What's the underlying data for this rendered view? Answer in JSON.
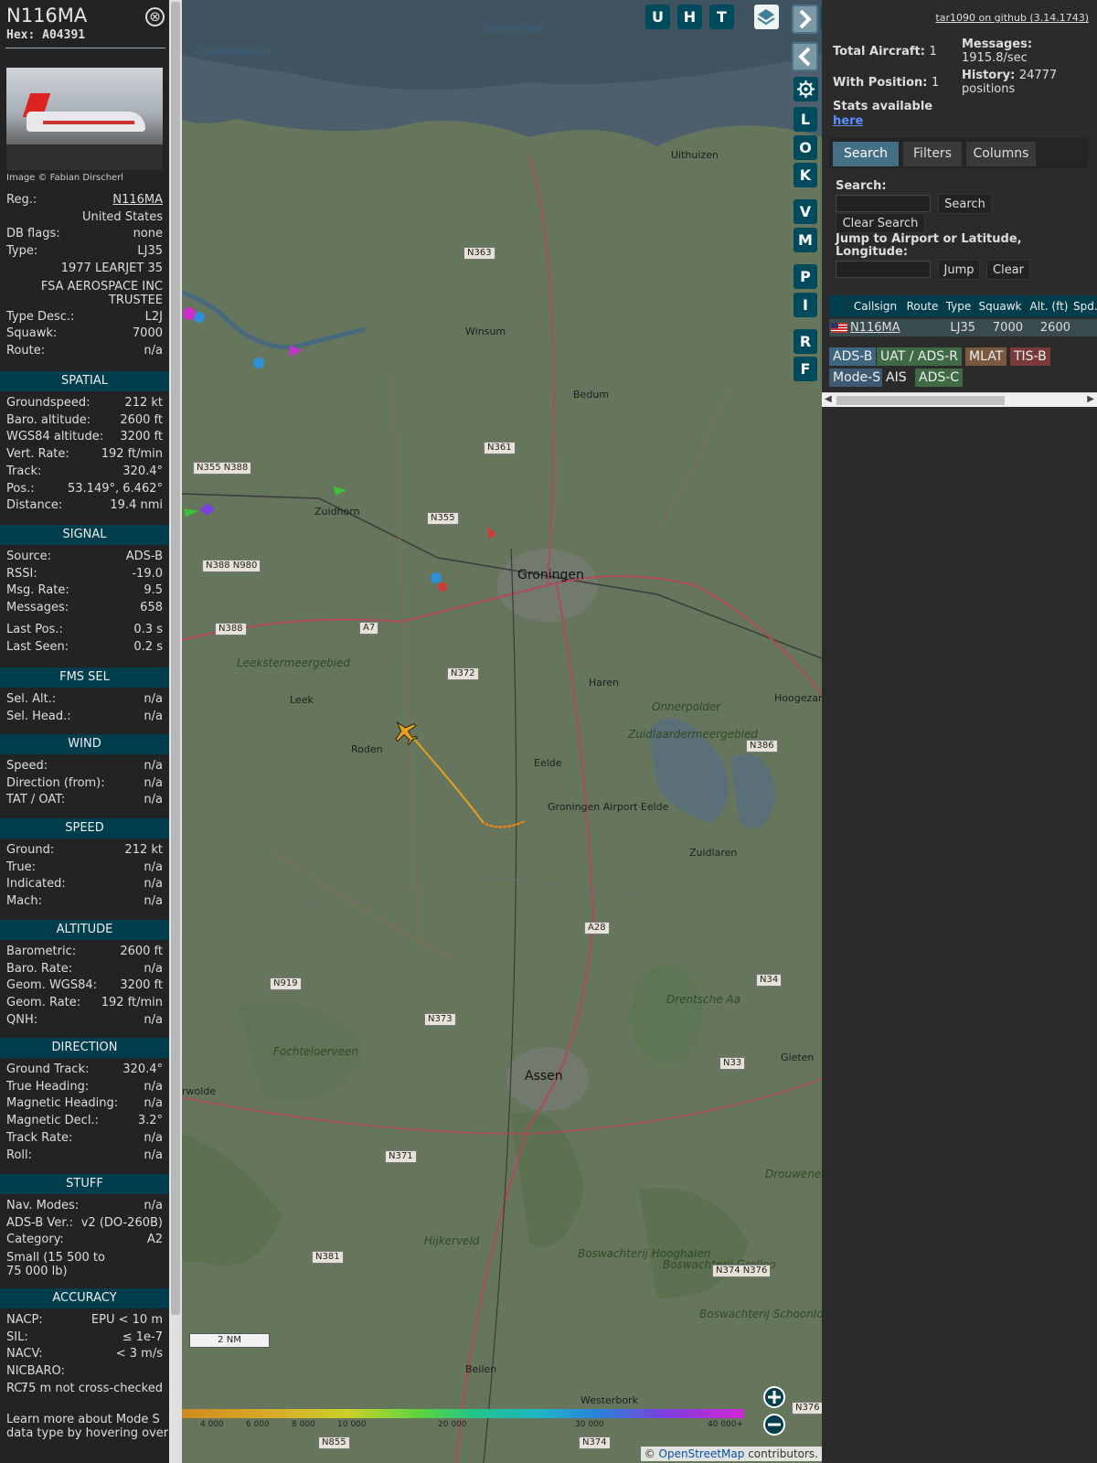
{
  "info": {
    "registration": "N116MA",
    "hex": "Hex: A04391",
    "close_icon": "⊗",
    "photo_credit": "Image © Fabian Dirscherl",
    "details": [
      {
        "k": "Reg.:",
        "v": "N116MA"
      },
      {
        "k": "",
        "v": "United States"
      },
      {
        "k": "DB flags:",
        "v": "none"
      },
      {
        "k": "Type:",
        "v": "LJ35"
      },
      {
        "k": "",
        "v": "1977 LEARJET 35"
      },
      {
        "k": "",
        "v": "FSA AEROSPACE INC TRUSTEE"
      },
      {
        "k": "Type Desc.:",
        "v": "L2J"
      },
      {
        "k": "Squawk:",
        "v": "7000"
      },
      {
        "k": "Route:",
        "v": "n/a"
      }
    ],
    "sections": {
      "spatial": "SPATIAL",
      "signal": "SIGNAL",
      "fms": "FMS SEL",
      "wind": "WIND",
      "speed": "SPEED",
      "altitude": "ALTITUDE",
      "direction": "DIRECTION",
      "stuff": "STUFF",
      "accuracy": "ACCURACY"
    },
    "spatial": [
      {
        "k": "Groundspeed:",
        "v": "212 kt"
      },
      {
        "k": "Baro. altitude:",
        "v": "2600 ft"
      },
      {
        "k": "WGS84 altitude:",
        "v": "3200 ft"
      },
      {
        "k": "Vert. Rate:",
        "v": "192 ft/min"
      },
      {
        "k": "Track:",
        "v": "320.4°"
      },
      {
        "k": "Pos.:",
        "v": "53.149°, 6.462°"
      },
      {
        "k": "Distance:",
        "v": "19.4 nmi"
      }
    ],
    "signal": [
      {
        "k": "Source:",
        "v": "ADS-B"
      },
      {
        "k": "RSSI:",
        "v": "-19.0"
      },
      {
        "k": "Msg. Rate:",
        "v": "9.5"
      },
      {
        "k": "Messages:",
        "v": "658"
      },
      {
        "k": "Last Pos.:",
        "v": "0.3 s"
      },
      {
        "k": "Last Seen:",
        "v": "0.2 s"
      }
    ],
    "fms": [
      {
        "k": "Sel. Alt.:",
        "v": "n/a"
      },
      {
        "k": "Sel. Head.:",
        "v": "n/a"
      }
    ],
    "wind": [
      {
        "k": "Speed:",
        "v": "n/a"
      },
      {
        "k": "Direction (from):",
        "v": "n/a"
      },
      {
        "k": "TAT / OAT:",
        "v": "n/a"
      }
    ],
    "speed": [
      {
        "k": "Ground:",
        "v": "212 kt"
      },
      {
        "k": "True:",
        "v": "n/a"
      },
      {
        "k": "Indicated:",
        "v": "n/a"
      },
      {
        "k": "Mach:",
        "v": "n/a"
      }
    ],
    "altitude": [
      {
        "k": "Barometric:",
        "v": "2600 ft"
      },
      {
        "k": "Baro. Rate:",
        "v": "n/a"
      },
      {
        "k": "Geom. WGS84:",
        "v": "3200 ft"
      },
      {
        "k": "Geom. Rate:",
        "v": "192 ft/min"
      },
      {
        "k": "QNH:",
        "v": "n/a"
      }
    ],
    "direction": [
      {
        "k": "Ground Track:",
        "v": "320.4°"
      },
      {
        "k": "True Heading:",
        "v": "n/a"
      },
      {
        "k": "Magnetic Heading:",
        "v": "n/a"
      },
      {
        "k": "Magnetic Decl.:",
        "v": "3.2°"
      },
      {
        "k": "Track Rate:",
        "v": "n/a"
      },
      {
        "k": "Roll:",
        "v": "n/a"
      }
    ],
    "stuff": [
      {
        "k": "Nav. Modes:",
        "v": "n/a"
      },
      {
        "k": "ADS-B Ver.:",
        "v": "v2 (DO-260B)"
      },
      {
        "k": "Category:",
        "v": "A2"
      }
    ],
    "category_desc": "Small (15 500 to 75 000 lb)",
    "accuracy": [
      {
        "k": "NACP:",
        "v": "EPU < 10 m"
      },
      {
        "k": "SIL:",
        "v": "≤ 1e-7"
      },
      {
        "k": "NACV:",
        "v": "< 3 m/s"
      },
      {
        "k": "NICBARO:",
        "v": ""
      },
      {
        "k": "RC:",
        "v": "75 m not cross-checked"
      }
    ],
    "learn_more": "Learn more about Mode S data type by hovering over"
  },
  "map": {
    "toolbar": [
      "U",
      "H",
      "T"
    ],
    "side_buttons": [
      "L",
      "O",
      "K",
      "V",
      "M",
      "P",
      "I",
      "R",
      "F"
    ],
    "places": [
      {
        "name": "Groningerwad",
        "cls": "water"
      },
      {
        "name": "Lauwerswal",
        "cls": "water"
      },
      {
        "name": "Uithuizen",
        "cls": ""
      },
      {
        "name": "Winsum",
        "cls": ""
      },
      {
        "name": "Bedum",
        "cls": ""
      },
      {
        "name": "Zuidhorn",
        "cls": ""
      },
      {
        "name": "Groningen",
        "cls": "big"
      },
      {
        "name": "Haren",
        "cls": ""
      },
      {
        "name": "Hoogezand",
        "cls": ""
      },
      {
        "name": "Leek",
        "cls": ""
      },
      {
        "name": "Roden",
        "cls": ""
      },
      {
        "name": "Eelde",
        "cls": ""
      },
      {
        "name": "Groningen Airport Eelde",
        "cls": ""
      },
      {
        "name": "Zuidlaren",
        "cls": ""
      },
      {
        "name": "Drentsche Aa",
        "cls": "park"
      },
      {
        "name": "Fochteloerveen",
        "cls": "park"
      },
      {
        "name": "Assen",
        "cls": "big"
      },
      {
        "name": "Gieten",
        "cls": ""
      },
      {
        "name": "rwolde",
        "cls": ""
      },
      {
        "name": "Hijkerveld",
        "cls": "park"
      },
      {
        "name": "Boswachterij Hooghalen",
        "cls": "park"
      },
      {
        "name": "Boswachterij Grolloo",
        "cls": "park"
      },
      {
        "name": "Boswachterij Schoonloo",
        "cls": "park"
      },
      {
        "name": "Beilen",
        "cls": ""
      },
      {
        "name": "Westerbork",
        "cls": ""
      },
      {
        "name": "Drouwenerveld",
        "cls": "park"
      },
      {
        "name": "Leekstermeergebied",
        "cls": "park"
      },
      {
        "name": "Onnerpolder",
        "cls": "park"
      },
      {
        "name": "Zuidlaardermeergebied",
        "cls": "park"
      }
    ],
    "roads": [
      "N363",
      "N361",
      "N355",
      "N355 N388",
      "N388 N980",
      "N388",
      "A7",
      "N372",
      "N386",
      "N919",
      "N373",
      "N33",
      "N34",
      "N371",
      "N381",
      "N374 N376",
      "A28",
      "N855",
      "N374",
      "N376"
    ],
    "scale": "2 NM",
    "attribution": {
      "prefix": "©",
      "link": "OpenStreetMap",
      "suffix": "contributors."
    },
    "alt_ticks": [
      "4 000",
      "6 000",
      "8 000",
      "10 000",
      "20 000",
      "30 000",
      "40 000+"
    ]
  },
  "right": {
    "github": "tar1090 on github (3.14.1743)",
    "total_aircraft_label": "Total Aircraft:",
    "total_aircraft": "1",
    "with_position_label": "With Position:",
    "with_position": "1",
    "messages_label": "Messages:",
    "messages": "1915.8/sec",
    "history_label": "History:",
    "history": "24777 positions",
    "stats_label": "Stats available",
    "here": "here",
    "tabs": [
      "Search",
      "Filters",
      "Columns"
    ],
    "search_label": "Search:",
    "search_button": "Search",
    "clear_search_button": "Clear Search",
    "jump_label": "Jump to Airport or Latitude, Longitude:",
    "jump_button": "Jump",
    "clear_button": "Clear",
    "columns": [
      "",
      "Callsign",
      "Route",
      "Type",
      "Squawk",
      "Alt. (ft)",
      "Spd."
    ],
    "rows": [
      {
        "callsign": "N116MA",
        "route": "",
        "type": "LJ35",
        "squawk": "7000",
        "alt": "2600",
        "spd": ""
      }
    ],
    "source_chips": [
      {
        "label": "ADS-B",
        "color": "#3e6680"
      },
      {
        "label": "UAT / ADS-R",
        "color": "#3e6a45"
      },
      {
        "label": "MLAT",
        "color": "#7a5a3f"
      },
      {
        "label": "TIS-B",
        "color": "#7a3a3a"
      },
      {
        "label": "Mode-S",
        "color": "#3e5a73"
      },
      {
        "label": "AIS",
        "color": "#2b2b2b"
      },
      {
        "label": "ADS-C",
        "color": "#3e6a45"
      }
    ]
  }
}
